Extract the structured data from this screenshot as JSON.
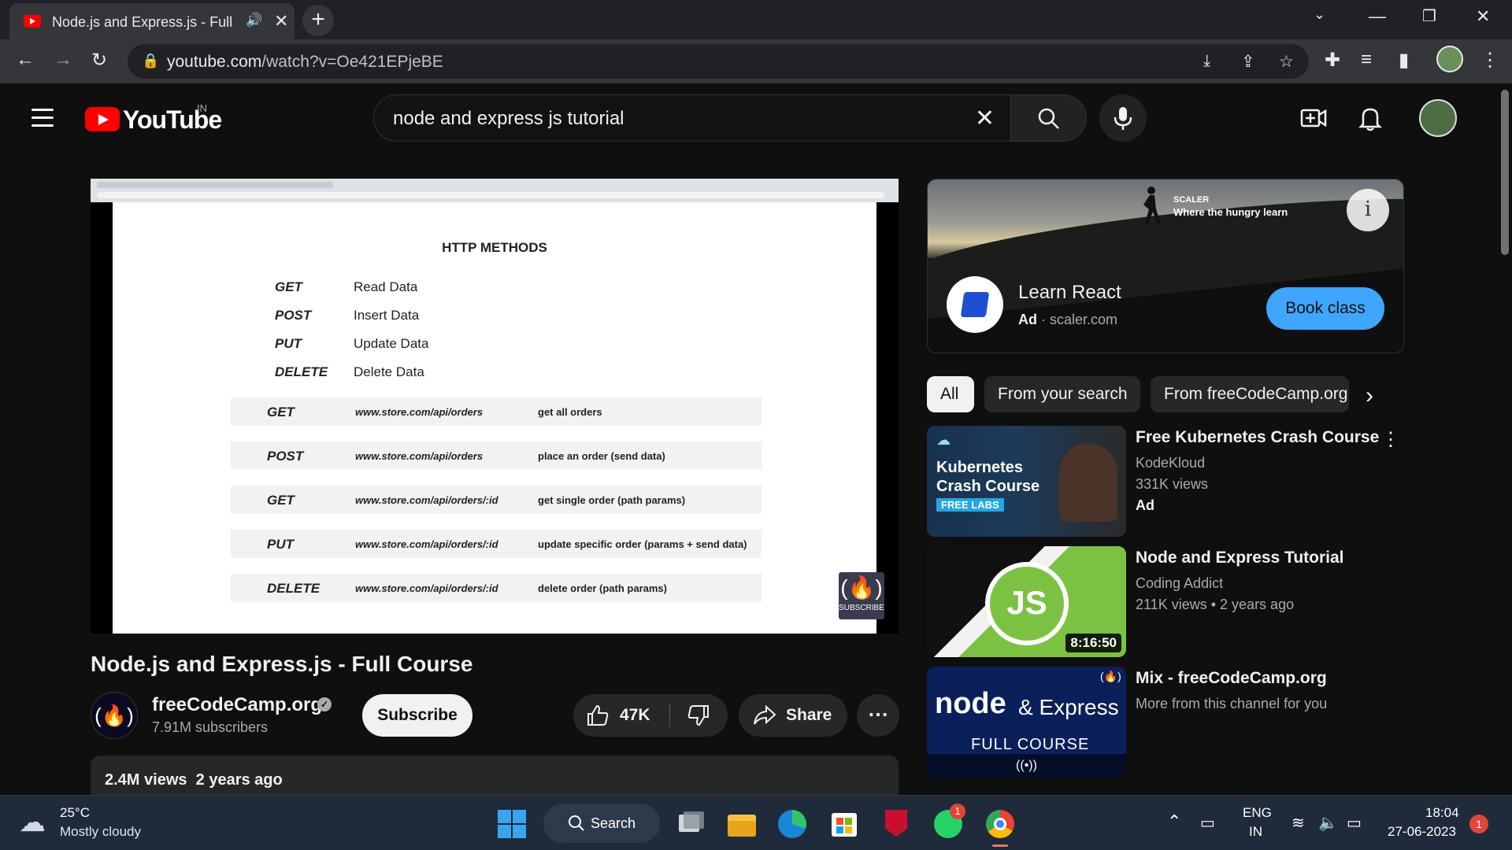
{
  "browser": {
    "tab_title": "Node.js and Express.js - Full C",
    "new_tab_label": "+",
    "url_domain": "youtube.com",
    "url_path": "/watch?v=Oe421EPjeBE"
  },
  "youtube": {
    "logo_text": "YouTube",
    "country_code": "IN",
    "search_query": "node and express js tutorial"
  },
  "slide": {
    "title": "HTTP METHODS",
    "methods": [
      {
        "method": "GET",
        "desc": "Read Data"
      },
      {
        "method": "POST",
        "desc": "Insert Data"
      },
      {
        "method": "PUT",
        "desc": "Update Data"
      },
      {
        "method": "DELETE",
        "desc": "Delete Data"
      }
    ],
    "routes": [
      {
        "method": "GET",
        "url": "www.store.com/api/orders",
        "note": "get all orders"
      },
      {
        "method": "POST",
        "url": "www.store.com/api/orders",
        "note": "place an order (send data)"
      },
      {
        "method": "GET",
        "url": "www.store.com/api/orders/:id",
        "note": "get single order (path params)"
      },
      {
        "method": "PUT",
        "url": "www.store.com/api/orders/:id",
        "note": "update specific order (params + send data)"
      },
      {
        "method": "DELETE",
        "url": "www.store.com/api/orders/:id",
        "note": "delete order (path params)"
      }
    ],
    "watermark_label": "SUBSCRIBE"
  },
  "video": {
    "title": "Node.js and Express.js - Full Course",
    "channel": "freeCodeCamp.org",
    "subscribers": "7.91M subscribers",
    "subscribe_label": "Subscribe",
    "likes": "47K",
    "share_label": "Share",
    "views": "2.4M views",
    "age": "2 years ago"
  },
  "ad": {
    "banner_brand": "SCALER",
    "banner_tagline": "Where the hungry learn",
    "title": "Learn React",
    "label": "Ad",
    "domain": "scaler.com",
    "cta": "Book class"
  },
  "chips": [
    "All",
    "From your search",
    "From freeCodeCamp.org"
  ],
  "recommendations": [
    {
      "title": "Free Kubernetes Crash Course",
      "channel": "KodeKloud",
      "views": "331K views",
      "extra": "Ad",
      "thumb_text1": "Kubernetes",
      "thumb_text2": "Crash Course",
      "thumb_badge": "FREE LABS"
    },
    {
      "title": "Node and Express Tutorial",
      "channel": "Coding Addict",
      "views": "211K views",
      "age": "2 years ago",
      "duration": "8:16:50",
      "thumb_text1": "JS"
    },
    {
      "title": "Mix - freeCodeCamp.org",
      "channel": "More from this channel for you",
      "thumb_text1": "node",
      "thumb_text2": "& Express",
      "thumb_badge": "FULL COURSE"
    }
  ],
  "taskbar": {
    "weather_temp": "25°C",
    "weather_desc": "Mostly cloudy",
    "search_label": "Search",
    "lang_top": "ENG",
    "lang_bottom": "IN",
    "time": "18:04",
    "date": "27-06-2023",
    "notif_count": "1",
    "whatsapp_badge": "1"
  },
  "colors": {
    "yt_red": "#ff0000",
    "accent_blue": "#3ea6ff",
    "bg": "#0f0f0f"
  }
}
